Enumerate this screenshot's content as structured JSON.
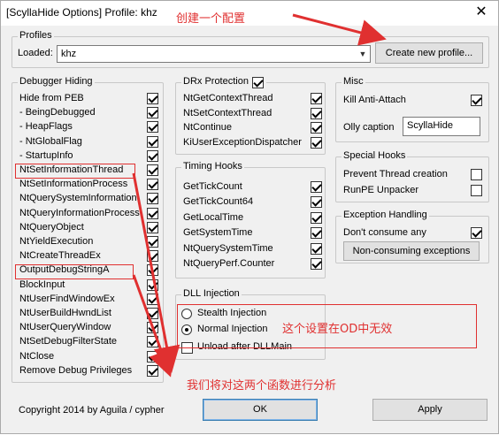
{
  "window": {
    "title": "[ScyllaHide Options] Profile: khz",
    "close_glyph": "✕"
  },
  "annotations": {
    "create_profile": "创建一个配置",
    "od_invalid": "这个设置在OD中无效",
    "analyze_funcs": "我们将对这两个函数进行分析"
  },
  "profiles": {
    "title": "Profiles",
    "loaded_label": "Loaded:",
    "loaded_value": "khz",
    "create_button": "Create new profile..."
  },
  "debugger_hiding": {
    "title": "Debugger Hiding",
    "items": [
      {
        "label": "Hide from PEB",
        "checked": true
      },
      {
        "label": "- BeingDebugged",
        "checked": true
      },
      {
        "label": "- HeapFlags",
        "checked": true
      },
      {
        "label": "- NtGlobalFlag",
        "checked": true
      },
      {
        "label": "- StartupInfo",
        "checked": true
      },
      {
        "label": "NtSetInformationThread",
        "checked": true
      },
      {
        "label": "NtSetInformationProcess",
        "checked": true
      },
      {
        "label": "NtQuerySystemInformation",
        "checked": true
      },
      {
        "label": "NtQueryInformationProcess",
        "checked": true
      },
      {
        "label": "NtQueryObject",
        "checked": true
      },
      {
        "label": "NtYieldExecution",
        "checked": true
      },
      {
        "label": "NtCreateThreadEx",
        "checked": true
      },
      {
        "label": "OutputDebugStringA",
        "checked": true
      },
      {
        "label": "BlockInput",
        "checked": true
      },
      {
        "label": "NtUserFindWindowEx",
        "checked": true
      },
      {
        "label": "NtUserBuildHwndList",
        "checked": true
      },
      {
        "label": "NtUserQueryWindow",
        "checked": true
      },
      {
        "label": "NtSetDebugFilterState",
        "checked": true
      },
      {
        "label": "NtClose",
        "checked": true
      },
      {
        "label": "Remove Debug Privileges",
        "checked": true
      }
    ]
  },
  "drx_protection": {
    "title": "DRx Protection",
    "enabled": true,
    "items": [
      {
        "label": "NtGetContextThread",
        "checked": true
      },
      {
        "label": "NtSetContextThread",
        "checked": true
      },
      {
        "label": "NtContinue",
        "checked": true
      },
      {
        "label": "KiUserExceptionDispatcher",
        "checked": true
      }
    ]
  },
  "timing_hooks": {
    "title": "Timing Hooks",
    "items": [
      {
        "label": "GetTickCount",
        "checked": true
      },
      {
        "label": "GetTickCount64",
        "checked": true
      },
      {
        "label": "GetLocalTime",
        "checked": true
      },
      {
        "label": "GetSystemTime",
        "checked": true
      },
      {
        "label": "NtQuerySystemTime",
        "checked": true
      },
      {
        "label": "NtQueryPerf.Counter",
        "checked": true
      }
    ]
  },
  "dll_injection": {
    "title": "DLL Injection",
    "stealth": "Stealth Injection",
    "normal": "Normal Injection",
    "selected": "normal",
    "unload": "Unload after DLLMain",
    "unload_checked": false
  },
  "misc": {
    "title": "Misc",
    "kill_label": "Kill Anti-Attach",
    "kill_checked": true,
    "olly_caption_label": "Olly caption",
    "olly_caption_value": "ScyllaHide"
  },
  "special_hooks": {
    "title": "Special Hooks",
    "items": [
      {
        "label": "Prevent Thread creation",
        "checked": false
      },
      {
        "label": "RunPE Unpacker",
        "checked": false
      }
    ]
  },
  "exception_handling": {
    "title": "Exception Handling",
    "dont_consume_label": "Don't consume any",
    "dont_consume_checked": true,
    "nonconsuming_button": "Non-consuming exceptions"
  },
  "footer": {
    "copyright": "Copyright 2014 by Aguila / cypher",
    "ok": "OK",
    "apply": "Apply"
  },
  "colors": {
    "annotation": "#e03030",
    "background": "#f0f0f0"
  }
}
